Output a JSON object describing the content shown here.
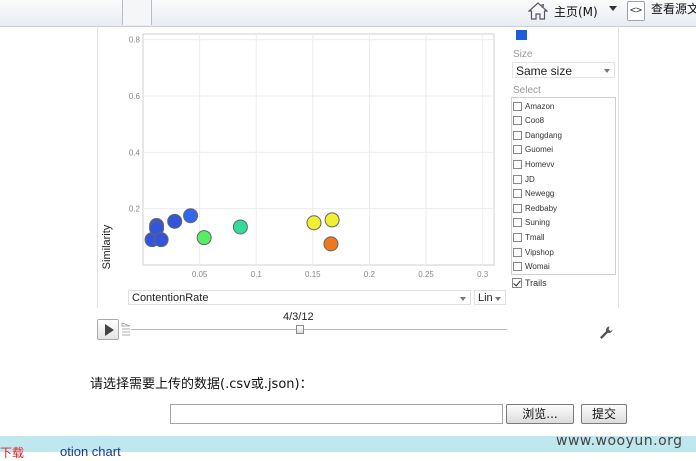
{
  "browser": {
    "home_label": "主页(M)",
    "view_source_label": "查看源文",
    "icons": [
      "home-icon",
      "dropdown-arrow-icon",
      "source-code-icon"
    ]
  },
  "chart_data": {
    "type": "scatter",
    "xlabel": "ContentionRate",
    "ylabel": "Similarity",
    "xlim": [
      0,
      0.31
    ],
    "ylim": [
      0,
      0.82
    ],
    "x_ticks": [
      0.05,
      0.1,
      0.15,
      0.2,
      0.25,
      0.3
    ],
    "y_ticks": [
      0.2,
      0.4,
      0.6,
      0.8
    ],
    "x_tick_labels": [
      "0.05",
      "0.1",
      "0.15",
      "0.2",
      "0.25",
      "0.3"
    ],
    "y_tick_labels": [
      "0.2",
      "0.4",
      "0.6",
      "0.8"
    ],
    "grid": true,
    "points": [
      {
        "x": 0.008,
        "y": 0.09,
        "color": "#3355dd"
      },
      {
        "x": 0.012,
        "y": 0.14,
        "color": "#3355dd"
      },
      {
        "x": 0.012,
        "y": 0.13,
        "color": "#3355dd"
      },
      {
        "x": 0.016,
        "y": 0.09,
        "color": "#3355dd"
      },
      {
        "x": 0.028,
        "y": 0.155,
        "color": "#3355dd"
      },
      {
        "x": 0.042,
        "y": 0.175,
        "color": "#3366ee"
      },
      {
        "x": 0.054,
        "y": 0.097,
        "color": "#55ee66"
      },
      {
        "x": 0.086,
        "y": 0.135,
        "color": "#33dd99"
      },
      {
        "x": 0.151,
        "y": 0.15,
        "color": "#f0f030"
      },
      {
        "x": 0.167,
        "y": 0.16,
        "color": "#f0f030"
      },
      {
        "x": 0.166,
        "y": 0.075,
        "color": "#ee7722"
      }
    ]
  },
  "panel": {
    "size_label": "Size",
    "size_value": "Same size",
    "select_label": "Select",
    "companies": [
      "Amazon",
      "Coo8",
      "Dangdang",
      "Guomei",
      "Homevv",
      "JD",
      "Newegg",
      "Redbaby",
      "Suning",
      "Tmall",
      "Vipshop",
      "Womai"
    ],
    "trails_label": "Trails",
    "accent_color": "#1e5fd6"
  },
  "controls": {
    "x_axis_select": "ContentionRate",
    "scale_select": "Lin",
    "time_value": "4/3/12",
    "time_progress": 0.45
  },
  "form": {
    "upload_label": "请选择需要上传的数据(.csv或.json)：",
    "browse_label": "浏览...",
    "submit_label": "提交"
  },
  "footer": {
    "text_red": "下载",
    "text_blue": "otion chart",
    "watermark": "www.wooyun.org"
  }
}
